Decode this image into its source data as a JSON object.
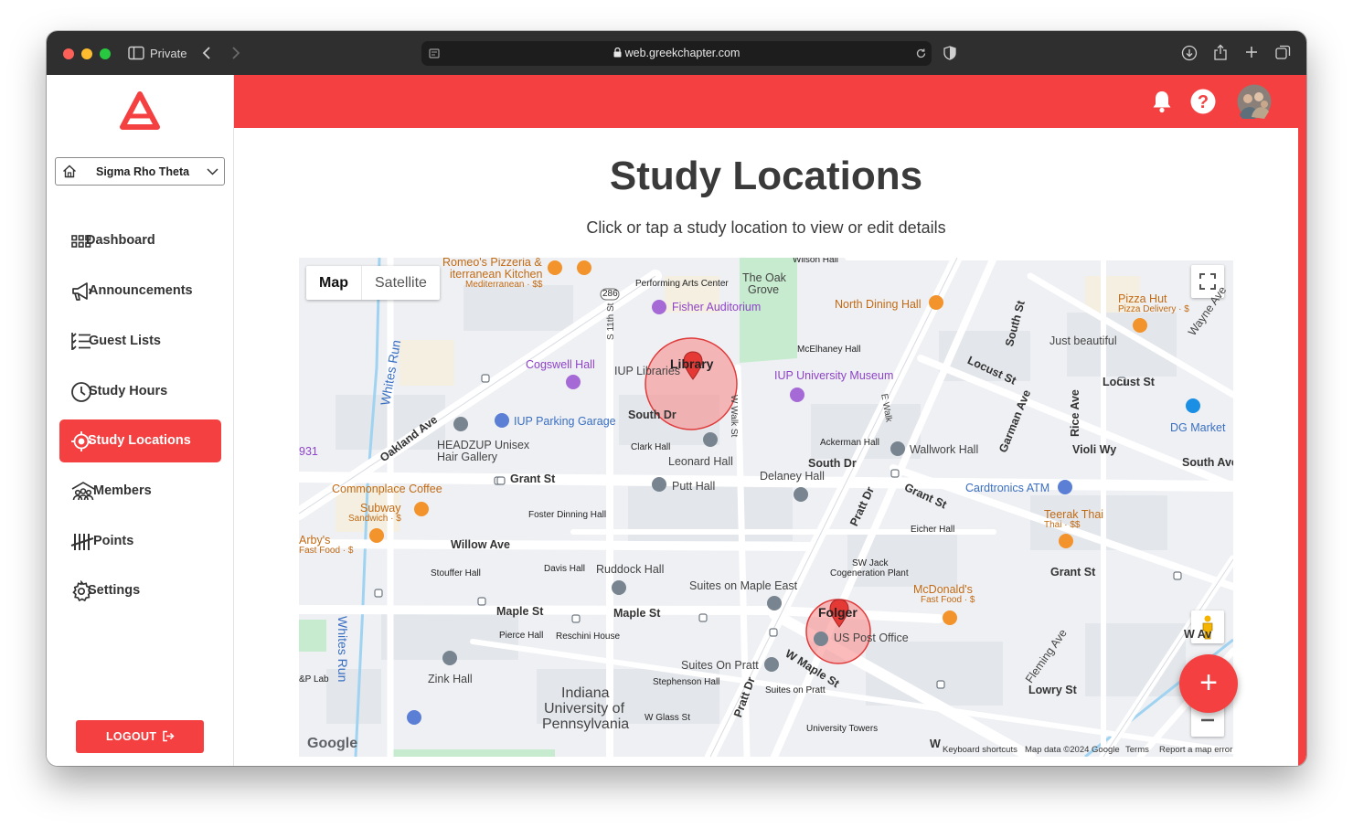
{
  "browser": {
    "private_label": "Private",
    "url": "web.greekchapter.com"
  },
  "sidebar": {
    "chapter": "Sigma Rho Theta",
    "items": [
      {
        "label": "Dashboard",
        "icon": "grid-icon"
      },
      {
        "label": "Announcements",
        "icon": "megaphone-icon"
      },
      {
        "label": "Guest Lists",
        "icon": "list-icon"
      },
      {
        "label": "Study Hours",
        "icon": "clock-icon"
      },
      {
        "label": "Study Locations",
        "icon": "target-icon",
        "active": true
      },
      {
        "label": "Members",
        "icon": "members-icon"
      },
      {
        "label": "Points",
        "icon": "tally-icon"
      },
      {
        "label": "Settings",
        "icon": "gear-icon"
      }
    ],
    "logout_label": "LOGOUT"
  },
  "header": {
    "accent": "#f44040"
  },
  "main": {
    "title": "Study Locations",
    "subtitle": "Click or tap a study location to view or edit details"
  },
  "map": {
    "map_type_map": "Map",
    "map_type_satellite": "Satellite",
    "markers": [
      {
        "label": "Library"
      },
      {
        "label": "Folger"
      }
    ],
    "labels": {
      "romeos": "Romeo's Pizzeria &",
      "romeos2": "iterranean Kitchen",
      "romeos3": "Mediterranean · $$",
      "pac": "Performing Arts Center",
      "wilson": "Wilson Hall",
      "oakgrove": "The Oak",
      "oakgrove2": "Grove",
      "fisher": "Fisher Auditorium",
      "northdining": "North Dining Hall",
      "pizzahut": "Pizza Hut",
      "pizzahut2": "Pizza Delivery · $",
      "southst": "South St",
      "wayne": "Wayne Ave",
      "mcelhaney": "McElhaney Hall",
      "justbeautiful": "Just beautiful",
      "locust1": "Locust St",
      "locust2": "Locust St",
      "cogswell": "Cogswell Hall",
      "iuplib": "IUP Libraries",
      "iupmuseum": "IUP University Museum",
      "whitesrun1": "Whites Run",
      "eleventh": "S 11th St",
      "wwalk": "W Walk St",
      "ewalk": "E Walk",
      "garman": "Garman Ave",
      "rice": "Rice Ave",
      "dgmarket": "DG Market",
      "oakland": "Oakland Ave",
      "parking": "IUP Parking Garage",
      "southdr1": "South Dr",
      "headzup": "HEADZUP Unisex",
      "headzup2": "Hair Gallery",
      "clark": "Clark Hall",
      "leonard": "Leonard Hall",
      "ackerman": "Ackerman Hall",
      "wallwork": "Wallwork Hall",
      "violi": "Violi Wy",
      "southave": "South Ave",
      "southdr2": "South Dr",
      "delaney": "Delaney Hall",
      "n931": "931",
      "grant1": "Grant St",
      "putt": "Putt Hall",
      "cardtronics": "Cardtronics ATM",
      "grant2": "Grant St",
      "commonplace": "Commonplace Coffee",
      "subway": "Subway",
      "subway2": "Sandwich · $",
      "foster": "Foster Dinning Hall",
      "prattdr1": "Pratt Dr",
      "teerak": "Teerak Thai",
      "teerak2": "Thai · $$",
      "eicher": "Eicher Hall",
      "arbys": "Arby's",
      "arbys2": "Fast Food · $",
      "willow": "Willow Ave",
      "swjack": "SW Jack",
      "swjack2": "Cogeneration Plant",
      "grant3": "Grant St",
      "stouffer": "Stouffer Hall",
      "davis": "Davis Hall",
      "ruddock": "Ruddock Hall",
      "suitesmaple": "Suites on Maple East",
      "mcdonalds": "McDonald's",
      "mcdonalds2": "Fast Food · $",
      "maple1": "Maple St",
      "maple2": "Maple St",
      "pierce": "Pierce Hall",
      "reschini": "Reschini House",
      "postoffice": "US Post Office",
      "whitesrun2": "Whites Run",
      "wmaple": "W Maple St",
      "suitespratt": "Suites On Pratt",
      "fleming": "Fleming Ave",
      "plab": "&P Lab",
      "zink": "Zink Hall",
      "stephenson": "Stephenson Hall",
      "suitespratt2": "Suites on Pratt",
      "lowry": "Lowry St",
      "indiana": "Indiana",
      "indiana2": "University of",
      "indiana3": "Pennsylvania",
      "wglass": "W Glass St",
      "prattdr2": "Pratt Dr",
      "univtowers": "University Towers",
      "w2": "W",
      "wav": "W    Av",
      "n286": "286"
    },
    "attribution": {
      "google": "Google",
      "shortcuts": "Keyboard shortcuts",
      "mapdata": "Map data ©2024 Google",
      "terms": "Terms",
      "report": "Report a map error"
    }
  },
  "fab_label": "+"
}
